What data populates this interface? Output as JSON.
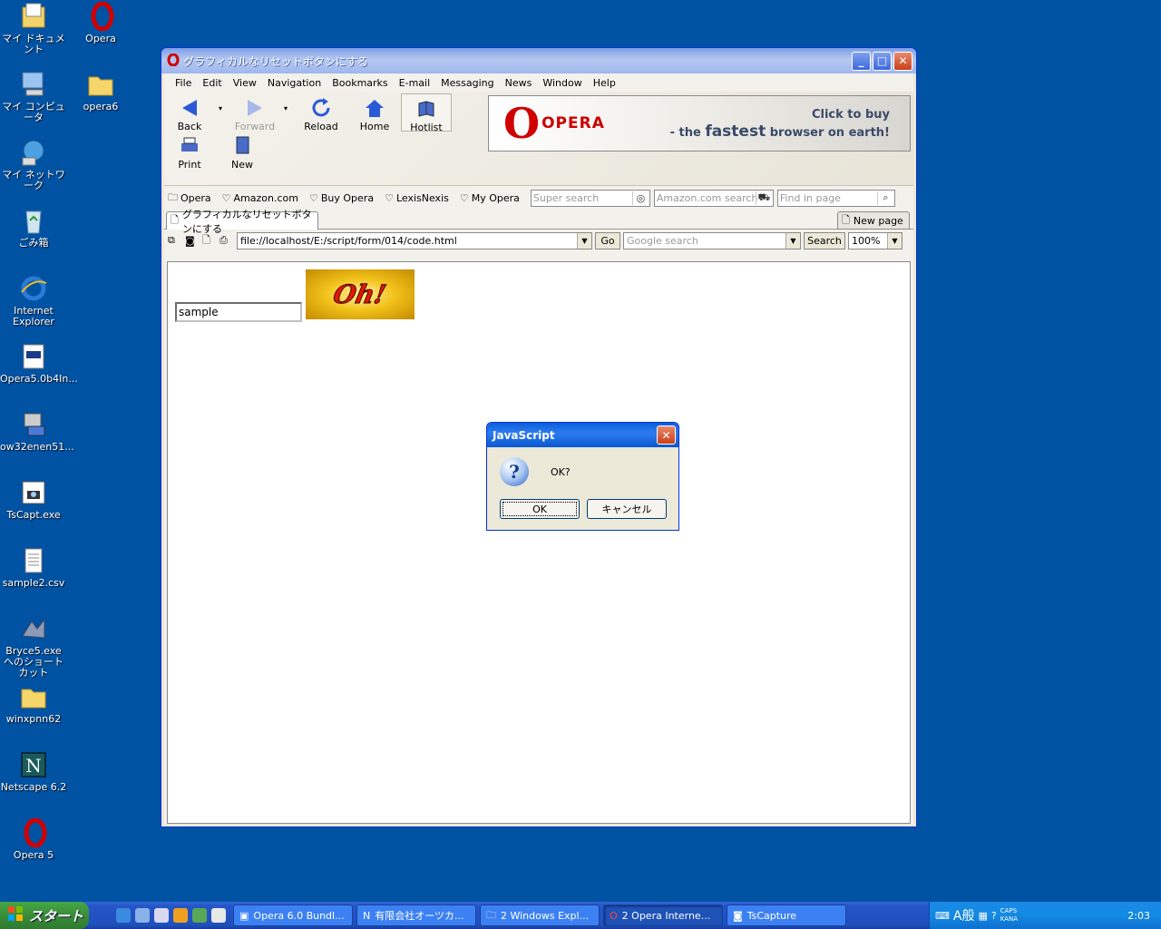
{
  "desktop_icons": [
    {
      "name": "my-documents",
      "label": "マイ ドキュメント"
    },
    {
      "name": "opera",
      "label": "Opera"
    },
    {
      "name": "my-computer",
      "label": "マイ コンピュータ"
    },
    {
      "name": "opera6-folder",
      "label": "opera6"
    },
    {
      "name": "my-network",
      "label": "マイ ネットワーク"
    },
    {
      "name": "recycle-bin",
      "label": "ごみ箱"
    },
    {
      "name": "internet-explorer",
      "label": "Internet Explorer"
    },
    {
      "name": "opera-installer",
      "label": "Opera5.0b4In..."
    },
    {
      "name": "ow32enen",
      "label": "ow32enen51..."
    },
    {
      "name": "tscapt",
      "label": "TsCapt.exe"
    },
    {
      "name": "sample2-csv",
      "label": "sample2.csv"
    },
    {
      "name": "bryce-shortcut",
      "label": "Bryce5.exe へのショートカット"
    },
    {
      "name": "winxpnn62",
      "label": "winxpnn62"
    },
    {
      "name": "netscape",
      "label": "Netscape 6.2"
    },
    {
      "name": "opera5",
      "label": "Opera 5"
    }
  ],
  "window": {
    "title": "グラフィカルなリセットボタンにする",
    "menu": [
      "File",
      "Edit",
      "View",
      "Navigation",
      "Bookmarks",
      "E-mail",
      "Messaging",
      "News",
      "Window",
      "Help"
    ],
    "toolbar": {
      "back": "Back",
      "forward": "Forward",
      "reload": "Reload",
      "home": "Home",
      "hotlist": "Hotlist",
      "print": "Print",
      "new": "New"
    },
    "banner": {
      "logo": "OPERA",
      "line1": "Click to buy",
      "line2_pre": "- the ",
      "line2_bold": "fastest",
      "line2_post": " browser on earth!"
    },
    "personal_bar": [
      "Opera",
      "Amazon.com",
      "Buy Opera",
      "LexisNexis",
      "My Opera"
    ],
    "search_boxes": {
      "super": "Super search",
      "amazon": "Amazon.com search",
      "find": "Find in page"
    },
    "tab": {
      "label": "グラフィカルなリセットボタンにする",
      "new_page": "New page"
    },
    "address": {
      "url": "file://localhost/E:/script/form/014/code.html",
      "go": "Go",
      "google_placeholder": "Google search",
      "search": "Search",
      "zoom": "100%"
    },
    "page": {
      "input_value": "sample",
      "image_text": "Oh!"
    }
  },
  "dialog": {
    "title": "JavaScript",
    "message": "OK?",
    "ok": "OK",
    "cancel": "キャンセル"
  },
  "taskbar": {
    "start": "スタート",
    "tasks": [
      "Opera 6.0 Bundl...",
      "有限会社オーツカ...",
      "2 Windows Expl...",
      "2 Opera Interne...",
      "TsCapture"
    ],
    "tray": {
      "caps": "CAPS",
      "kana": "KANA",
      "ime": "A般",
      "clock": "2:03"
    }
  }
}
